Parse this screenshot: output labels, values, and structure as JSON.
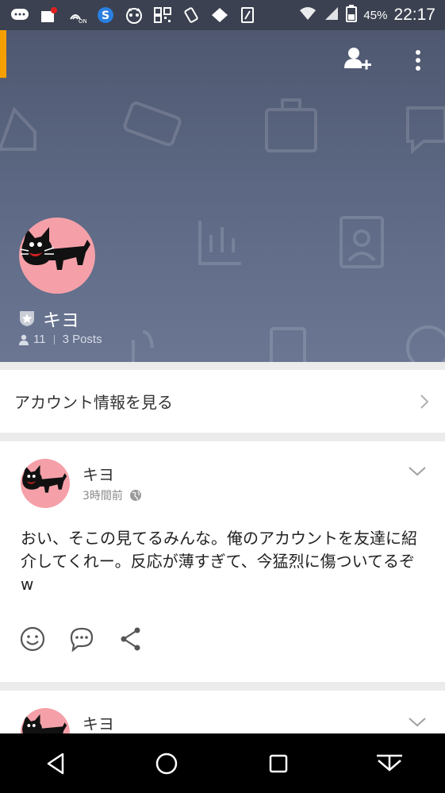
{
  "status_bar": {
    "battery": "45%",
    "time": "22:17",
    "icons": [
      "message-icon",
      "notification-icon",
      "nfc-icon",
      "s-app-icon",
      "raccoon-app-icon",
      "qr-icon",
      "vibrate-icon",
      "app-icon",
      "sim-icon",
      "wifi-icon",
      "signal-icon",
      "battery-icon"
    ]
  },
  "header": {
    "accent_color": "#f5a000",
    "icons": [
      "add-friend-icon",
      "more-menu-icon"
    ],
    "profile": {
      "name": "キヨ",
      "friends": "11",
      "posts": "3 Posts"
    }
  },
  "account": {
    "label": "アカウント情報を見る"
  },
  "posts": [
    {
      "author": "キヨ",
      "time": "3時間前",
      "body": "おい、そこの見てるみんな。俺のアカウントを友達に紹介してくれー。反応が薄すぎて、今猛烈に傷ついてるぞw",
      "actions": [
        "emoji-react-icon",
        "comment-icon",
        "share-icon"
      ]
    },
    {
      "author": "キヨ"
    }
  ],
  "nav_bar": {
    "icons": [
      "back-icon",
      "home-icon",
      "recents-icon",
      "notification-pull-icon"
    ]
  },
  "colors": {
    "header_bg": "#5e6a86",
    "avatar_bg": "#f5a0a8",
    "accent": "#f5a000"
  }
}
